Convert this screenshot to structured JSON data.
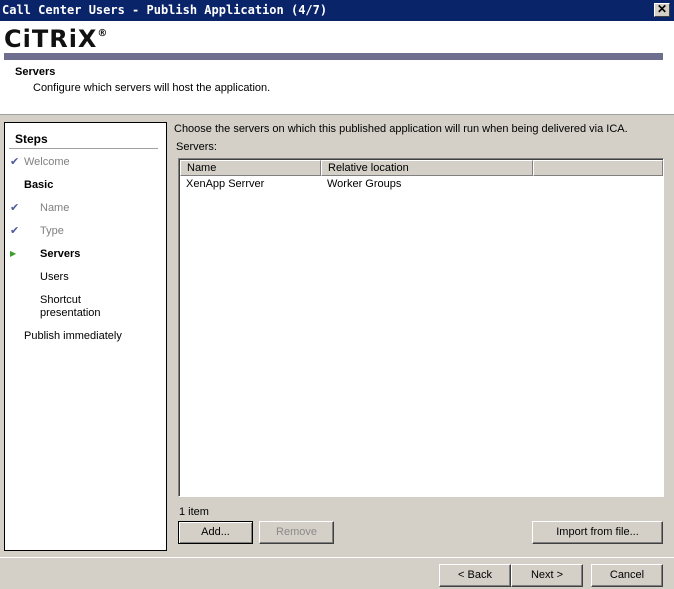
{
  "window": {
    "title": "Call Center Users - Publish Application (4/7)",
    "close_label": "✕"
  },
  "brand": {
    "logo_text": "CiTRiX",
    "logo_mark": "®"
  },
  "header": {
    "title": "Servers",
    "description": "Configure which servers will host the application."
  },
  "steps": {
    "heading": "Steps",
    "items": [
      {
        "label": "Welcome",
        "state": "done"
      },
      {
        "label": "Basic",
        "state": "group"
      },
      {
        "label": "Name",
        "state": "done"
      },
      {
        "label": "Type",
        "state": "done"
      },
      {
        "label": "Servers",
        "state": "current"
      },
      {
        "label": "Users",
        "state": "pending"
      },
      {
        "label": "Shortcut presentation",
        "label_line1": "Shortcut",
        "label_line2": "presentation",
        "state": "pending"
      },
      {
        "label": "Publish immediately",
        "state": "pending"
      }
    ]
  },
  "main": {
    "intro": "Choose the servers on which this published application will run when being delivered via ICA.",
    "servers_label": "Servers:",
    "columns": [
      "Name",
      "Relative location"
    ],
    "rows": [
      {
        "name": "XenApp Serrver",
        "location": "Worker Groups"
      }
    ],
    "item_count": "1 item",
    "add_label": "Add...",
    "remove_label": "Remove",
    "import_label": "Import from file..."
  },
  "footer": {
    "back_label": "< Back",
    "next_label": "Next >",
    "cancel_label": "Cancel"
  },
  "colors": {
    "titlebar": "#0a246a",
    "logo_bar": "#6e6e8e",
    "check": "#4a5a9a",
    "current_arrow": "#3aa02a",
    "dialog_bg": "#d4d0c8"
  },
  "icons": {
    "done": "checkmark-icon",
    "current": "arrow-right-icon"
  }
}
